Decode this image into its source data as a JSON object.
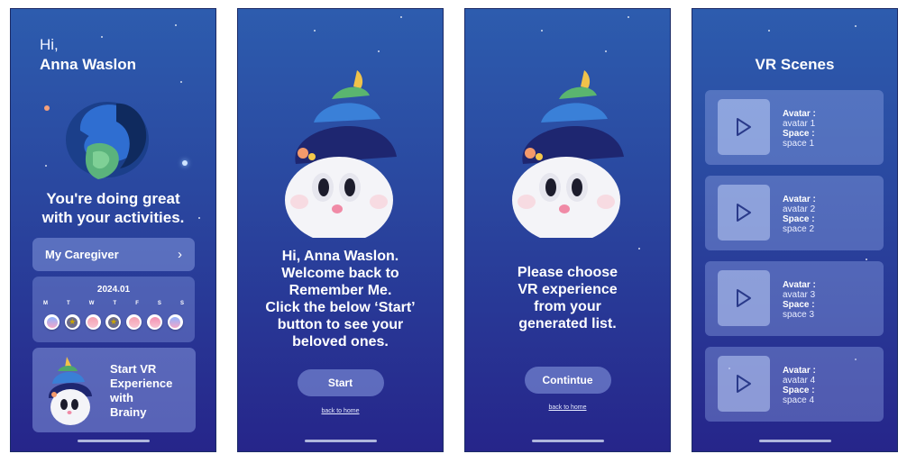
{
  "colors": {
    "background_top": "#2d5cae",
    "background_bottom": "#26258a",
    "card": "#8ea6ea",
    "text": "#ffffff"
  },
  "screen1": {
    "greeting": "Hi,",
    "user_name": "Anna Waslon",
    "encouragement": "You're doing great\nwith your activities.",
    "caregiver_label": "My Caregiver",
    "caregiver_icon": "chevron-right-icon",
    "calendar": {
      "month": "2024.01",
      "days": [
        "M",
        "T",
        "W",
        "T",
        "F",
        "S",
        "S"
      ],
      "badges": [
        {
          "day": "M",
          "icon": "sticker-badge"
        },
        {
          "day": "T",
          "icon": "star-badge"
        },
        {
          "day": "W",
          "icon": "sticker-badge"
        },
        {
          "day": "T",
          "icon": "star-badge"
        },
        {
          "day": "F",
          "icon": "sticker-badge"
        },
        {
          "day": "S",
          "icon": "sticker-badge"
        },
        {
          "day": "S",
          "icon": "sticker-badge"
        }
      ]
    },
    "vr_card_label": "Start VR\nExperience\nwith\nBrainy"
  },
  "screen2": {
    "message": "Hi, Anna Waslon.\nWelcome back to\nRemember Me.\nClick the below ‘Start’\nbutton to see your\nbeloved ones.",
    "start_label": "Start",
    "back_label": "back to home"
  },
  "screen3": {
    "message": "Please choose\nVR experience\nfrom your\ngenerated list.",
    "continue_label": "Contintue",
    "back_label": "back to home"
  },
  "screen4": {
    "title": "VR Scenes",
    "scenes": [
      {
        "avatar_label": "Avatar :",
        "avatar": "avatar 1",
        "space_label": "Space :",
        "space": "space 1"
      },
      {
        "avatar_label": "Avatar :",
        "avatar": "avatar 2",
        "space_label": "Space :",
        "space": "space 2"
      },
      {
        "avatar_label": "Avatar :",
        "avatar": "avatar 3",
        "space_label": "Space :",
        "space": "space 3"
      },
      {
        "avatar_label": "Avatar :",
        "avatar": "avatar 4",
        "space_label": "Space :",
        "space": "space 4"
      }
    ]
  }
}
